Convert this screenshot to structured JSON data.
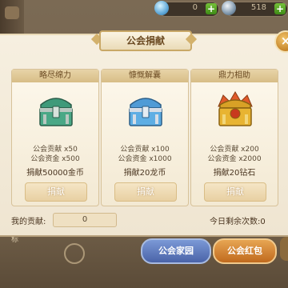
{
  "currency": [
    {
      "icon": "diamond-icon",
      "value": "0",
      "add_label": "+"
    },
    {
      "icon": "coin-icon",
      "value": "518",
      "add_label": "+"
    }
  ],
  "dialog": {
    "title": "公会捐献",
    "close_label": "×",
    "cards": [
      {
        "name": "略尽绵力",
        "chest_color": "#3f9a7a",
        "line1": "公会贡献 x50",
        "line2": "公会资金 x500",
        "requirement": "捐献50000金币",
        "button": "捐献"
      },
      {
        "name": "慷慨解囊",
        "chest_color": "#4f9bd6",
        "line1": "公会贡献 x100",
        "line2": "公会资金 x1000",
        "requirement": "捐献20龙币",
        "button": "捐献"
      },
      {
        "name": "鼎力相助",
        "chest_color": "#d8a126",
        "line1": "公会贡献 x200",
        "line2": "公会资金 x2000",
        "requirement": "捐献20钻石",
        "button": "捐献"
      }
    ],
    "my_contribution_label": "我的贡献:",
    "my_contribution_value": "0",
    "remaining_label": "今日剩余次数:",
    "remaining_value": "0"
  },
  "bottom": {
    "home_button": "公会家园",
    "red_button": "公会红包",
    "left_text": "标"
  }
}
